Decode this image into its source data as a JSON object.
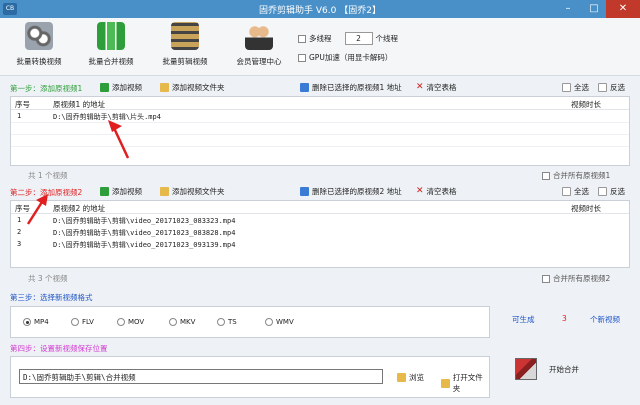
{
  "window": {
    "title": "固乔剪辑助手 V6.0 【固乔2】",
    "logo": "CB"
  },
  "toolbar": [
    {
      "label": "批量转换视频",
      "icon": "film-reel-icon"
    },
    {
      "label": "批量合并视频",
      "icon": "merge-grid-icon"
    },
    {
      "label": "批量剪辑视频",
      "icon": "film-strip-icon"
    },
    {
      "label": "会员管理中心",
      "icon": "users-icon"
    }
  ],
  "options": {
    "multithread_label": "多线程",
    "thread_count": "2",
    "thread_unit": "个线程",
    "gpu_label": "GPU加速（用显卡解码）"
  },
  "step1": {
    "label": "第一步：添加原视频1",
    "add_video": "添加视频",
    "add_folder": "添加视频文件夹",
    "delete_selected": "删除已选择的原视频1 地址",
    "clear_table": "清空表格",
    "select_all": "全选",
    "invert": "反选",
    "columns": {
      "index": "序号",
      "path": "原视频1 的地址",
      "duration": "视频时长"
    },
    "rows": [
      {
        "index": "1",
        "path": "D:\\固乔剪辑助手\\剪辑\\片头.mp4"
      }
    ],
    "count": "共 1 个视频",
    "merge_all": "合并所有原视频1"
  },
  "step2": {
    "label": "第二步：添加原视频2",
    "add_video": "添加视频",
    "add_folder": "添加视频文件夹",
    "delete_selected": "删除已选择的原视频2 地址",
    "clear_table": "清空表格",
    "select_all": "全选",
    "invert": "反选",
    "columns": {
      "index": "序号",
      "path": "原视频2 的地址",
      "duration": "视频时长"
    },
    "rows": [
      {
        "index": "1",
        "path": "D:\\固乔剪辑助手\\剪辑\\video_20171023_083323.mp4"
      },
      {
        "index": "2",
        "path": "D:\\固乔剪辑助手\\剪辑\\video_20171023_083828.mp4"
      },
      {
        "index": "3",
        "path": "D:\\固乔剪辑助手\\剪辑\\video_20171023_093139.mp4"
      }
    ],
    "count": "共 3 个视频",
    "merge_all": "合并所有原视频2"
  },
  "step3": {
    "label": "第三步：选择新视频格式",
    "formats": [
      "MP4",
      "FLV",
      "MOV",
      "MKV",
      "TS",
      "WMV"
    ],
    "selected": "MP4",
    "gen_prefix": "可生成",
    "gen_count": "3",
    "gen_suffix": "个新视频"
  },
  "step4": {
    "label": "第四步：设置新视频保存位置",
    "path": "D:\\固乔剪辑助手\\剪辑\\合并视频",
    "browse": "浏览",
    "open_folder": "打开文件夹",
    "start": "开始合并"
  },
  "colors": {
    "titlebar": "#4a90c8",
    "step1": "#2e9e3a",
    "step2": "#e02020",
    "step3": "#1e55c8",
    "step4": "#d43ad4",
    "arrow": "#e02020"
  }
}
